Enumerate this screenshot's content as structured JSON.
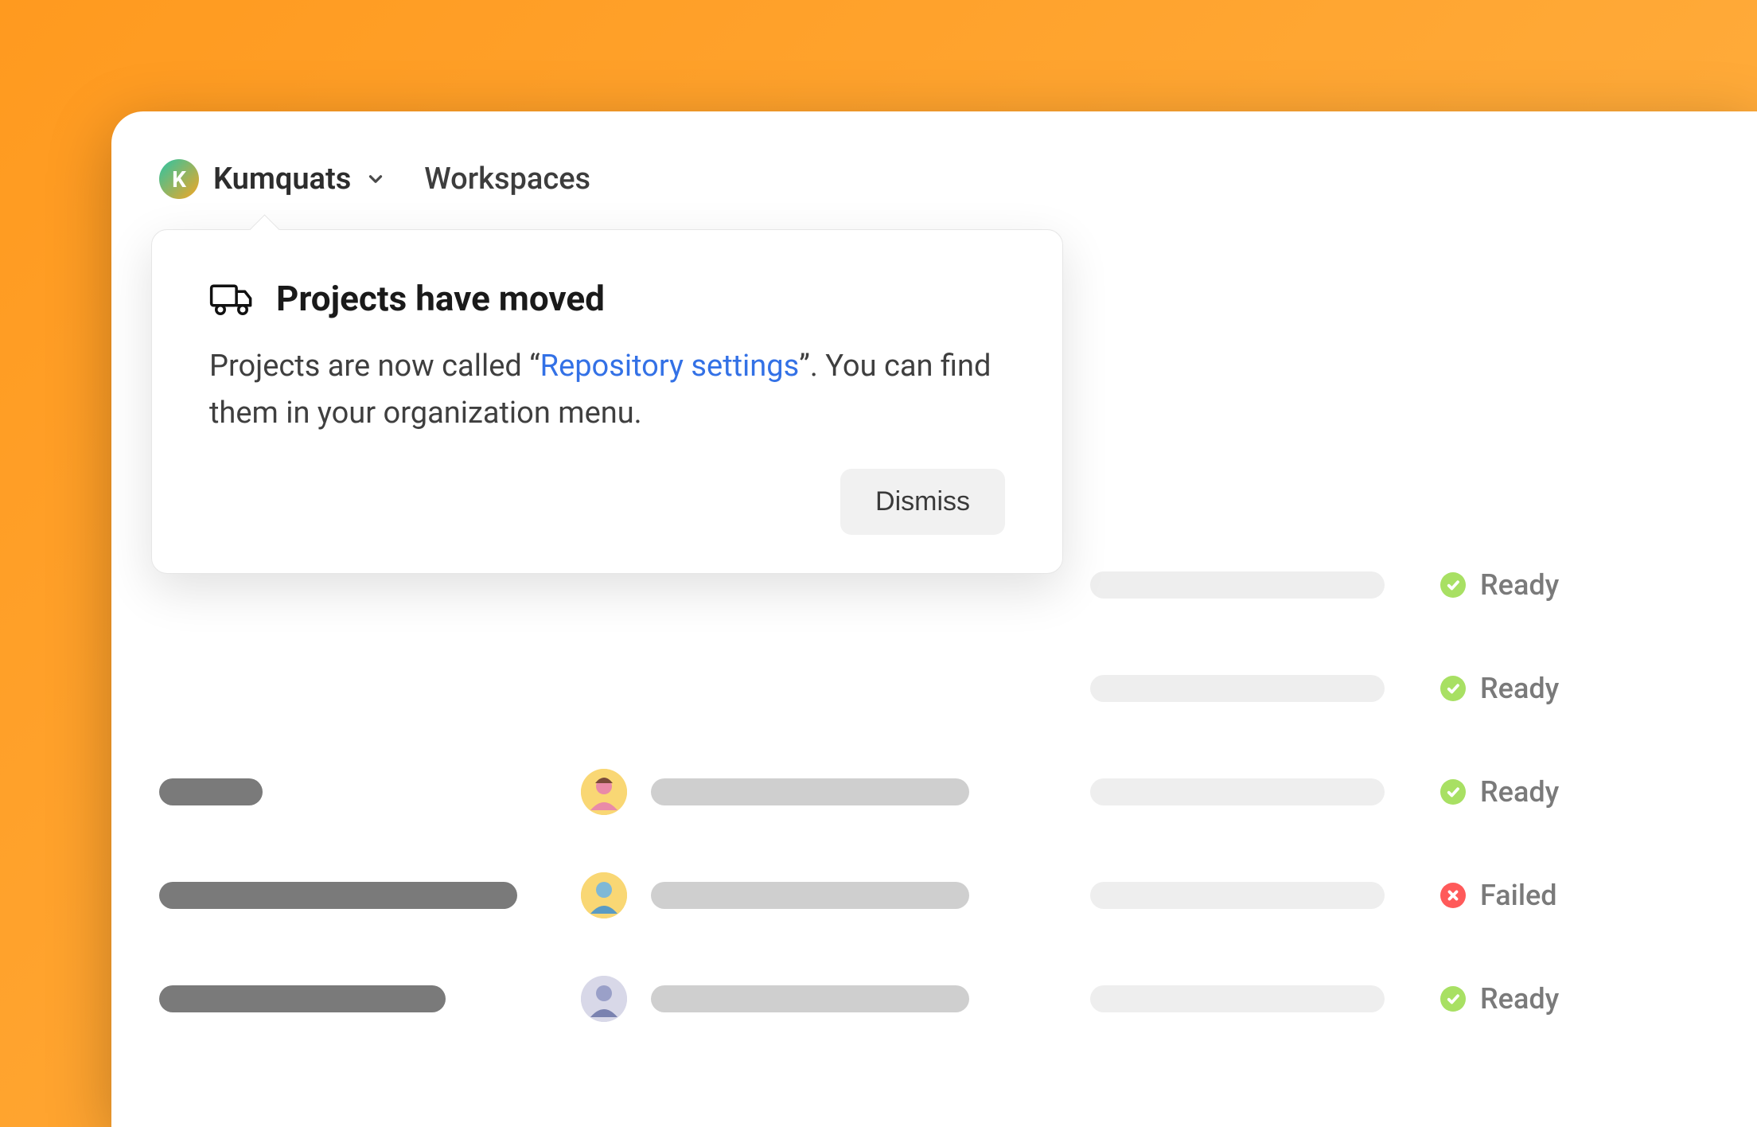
{
  "org": {
    "name": "Kumquats",
    "initial": "K"
  },
  "nav": {
    "workspaces": "Workspaces"
  },
  "popover": {
    "title": "Projects have moved",
    "body_prefix": "Projects are now called “",
    "link_text": "Repository settings",
    "body_suffix": "”. You can find them in your organization menu.",
    "dismiss": "Dismiss"
  },
  "statuses": {
    "ready": "Ready",
    "failed": "Failed"
  },
  "rows": [
    {
      "status": "ready"
    },
    {
      "status": "ready"
    },
    {
      "status": "ready"
    },
    {
      "status": "failed"
    },
    {
      "status": "ready"
    }
  ]
}
